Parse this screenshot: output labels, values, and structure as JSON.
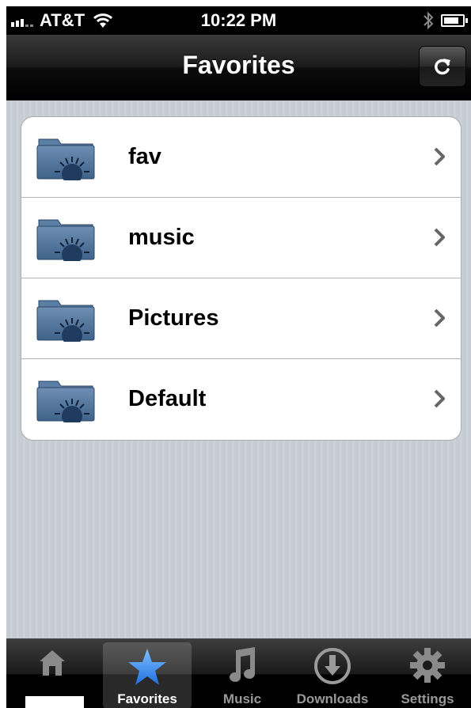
{
  "status_bar": {
    "carrier": "AT&T",
    "time": "10:22 PM"
  },
  "nav_bar": {
    "title": "Favorites"
  },
  "folders": [
    {
      "label": "fav"
    },
    {
      "label": "music"
    },
    {
      "label": "Pictures"
    },
    {
      "label": "Default"
    }
  ],
  "tab_bar": {
    "tabs": [
      {
        "label": "",
        "icon": "home-icon"
      },
      {
        "label": "Favorites",
        "icon": "star-icon",
        "selected": true
      },
      {
        "label": "Music",
        "icon": "music-note-icon"
      },
      {
        "label": "Downloads",
        "icon": "download-icon"
      },
      {
        "label": "Settings",
        "icon": "gear-icon"
      }
    ]
  },
  "colors": {
    "star_blue": "#3f8ef0",
    "folder_blue": "#4b6f96"
  }
}
